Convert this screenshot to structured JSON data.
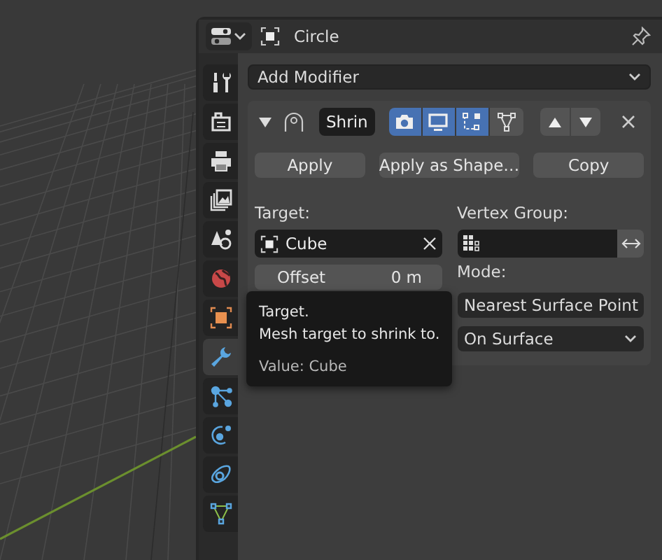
{
  "header": {
    "object_name": "Circle"
  },
  "tabs": [
    {
      "kind": "tool",
      "selected": false
    },
    {
      "kind": "render",
      "selected": false
    },
    {
      "kind": "output",
      "selected": false
    },
    {
      "kind": "view_layer",
      "selected": false
    },
    {
      "kind": "scene",
      "selected": false
    },
    {
      "kind": "world",
      "selected": false
    },
    {
      "kind": "object",
      "selected": false
    },
    {
      "kind": "modifiers",
      "selected": true
    },
    {
      "kind": "particles",
      "selected": false
    },
    {
      "kind": "physics",
      "selected": false
    },
    {
      "kind": "constraints",
      "selected": false
    },
    {
      "kind": "data",
      "selected": false
    }
  ],
  "add_modifier": "Add Modifier",
  "modifier": {
    "expanded": true,
    "name": "Shrin",
    "toggles": [
      {
        "kind": "render",
        "on": true
      },
      {
        "kind": "viewport",
        "on": true
      },
      {
        "kind": "editmode",
        "on": true
      },
      {
        "kind": "cage",
        "on": false
      }
    ],
    "buttons": [
      "Apply",
      "Apply as Shape…",
      "Copy"
    ],
    "target_label": "Target:",
    "target_value": "Cube",
    "vertex_group_label": "Vertex Group:",
    "offset_label": "Offset",
    "offset_value": "0 m",
    "mode_label": "Mode:",
    "wrap_method": "Nearest Surface Point",
    "snap_mode": "On Surface"
  },
  "tooltip": {
    "title": "Target.",
    "description": "Mesh target to shrink to.",
    "value": "Value: Cube"
  }
}
